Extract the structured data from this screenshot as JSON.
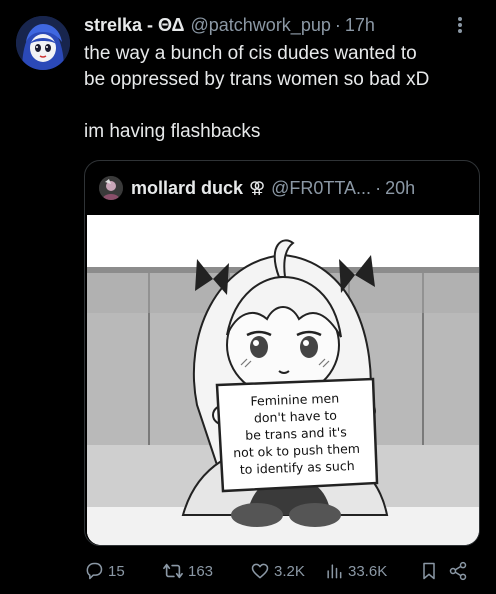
{
  "tweet": {
    "avatar_icon": "user-avatar",
    "display_name": "strelka - ΘΔ",
    "handle": "@patchwork_pup",
    "separator": "·",
    "time": "17h",
    "more_icon": "more-vertical-icon",
    "text_lines": [
      "the way a bunch of cis dudes wanted to",
      "be oppressed by trans women so bad xD",
      "",
      "im having flashbacks"
    ]
  },
  "quoted": {
    "avatar_icon": "quoted-user-avatar",
    "display_name": "mollard duck",
    "badge_icon": "venus-mars-symbol-icon",
    "badge": "⚢",
    "handle": "@FR0TTA...",
    "separator": "·",
    "time": "20h",
    "image": {
      "description_icon": "anime-character-holding-sign-image",
      "sign_lines": [
        "Feminine men",
        "don't have to",
        "be trans and it's",
        "not ok to push them",
        "to identify as such"
      ]
    }
  },
  "actions": {
    "replies": "15",
    "retweets": "163",
    "likes": "3.2K",
    "views": "33.6K"
  },
  "colors": {
    "background": "#000000",
    "text": "#e7e9ea",
    "muted": "#8b98a5",
    "border": "#2f3336"
  }
}
